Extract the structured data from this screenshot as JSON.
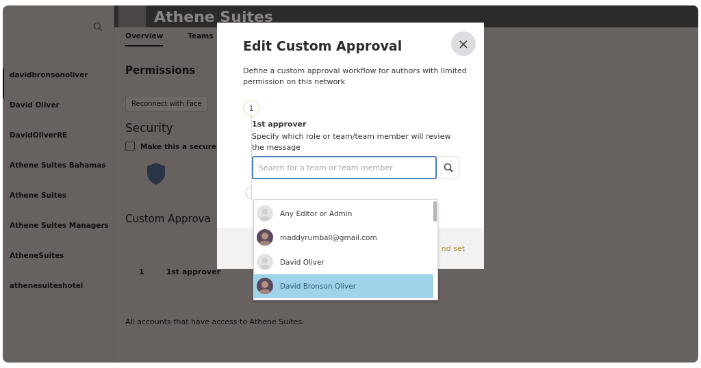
{
  "sidebar": {
    "items": [
      {
        "label": "davidbronsonoliver",
        "selected": true
      },
      {
        "label": "David Oliver",
        "selected": false
      },
      {
        "label": "DavidOliverRE",
        "selected": false
      },
      {
        "label": "Athene Suites Bahamas",
        "selected": false
      },
      {
        "label": "Athene Suites",
        "selected": false
      },
      {
        "label": "Athene Suites Managers",
        "selected": false
      },
      {
        "label": "AtheneSuites",
        "selected": false
      },
      {
        "label": "athenesuiteshotel",
        "selected": false
      }
    ]
  },
  "header": {
    "title": "Athene Suites"
  },
  "tabs": [
    {
      "label": "Overview",
      "selected": true
    },
    {
      "label": "Teams",
      "selected": false
    }
  ],
  "page": {
    "permissions_title": "Permissions",
    "reconnect_button": "Reconnect with Face",
    "security_title": "Security",
    "secure_option": {
      "label": "Make this a secure",
      "checked": false
    },
    "custom_approval_title": "Custom Approva",
    "step_number": "1",
    "step_label": "1st approver",
    "accounts_heading": "All accounts that have access to Athene Suites:"
  },
  "modal": {
    "title": "Edit Custom Approval",
    "close": "×",
    "description": "Define a custom approval workflow for authors with limited permission on this network",
    "step_number": "1",
    "step_title": "1st approver",
    "step_description": "Specify which role or team/team member will review the message",
    "search": {
      "placeholder": "Search for a team or team member"
    },
    "footer_button": "nd set"
  },
  "dropdown": {
    "options": [
      {
        "label": "Any Editor or Admin",
        "kind": "placeholder",
        "selected": false
      },
      {
        "label": "maddyrumball@gmail.com",
        "kind": "photo",
        "selected": false
      },
      {
        "label": "David Oliver",
        "kind": "placeholder",
        "selected": false
      },
      {
        "label": "David Bronson Oliver",
        "kind": "photo",
        "selected": true
      }
    ]
  }
}
